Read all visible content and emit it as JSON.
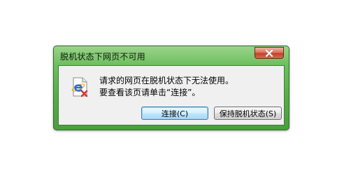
{
  "window": {
    "title": "脱机状态下网页不可用"
  },
  "icons": {
    "app_icon": "ie-offline-error-icon",
    "close_icon": "close-icon"
  },
  "message": {
    "line1": "请求的网页在脱机状态下无法使用。",
    "line2": "要查看该页请单击“连接”。"
  },
  "buttons": {
    "connect_label": "连接(C)",
    "stay_offline_label": "保持脱机状态(S)"
  },
  "colors": {
    "frame": "#57ad48",
    "close": "#c2432a",
    "client": "#f0f0f0",
    "error_mark": "#d9362a"
  }
}
